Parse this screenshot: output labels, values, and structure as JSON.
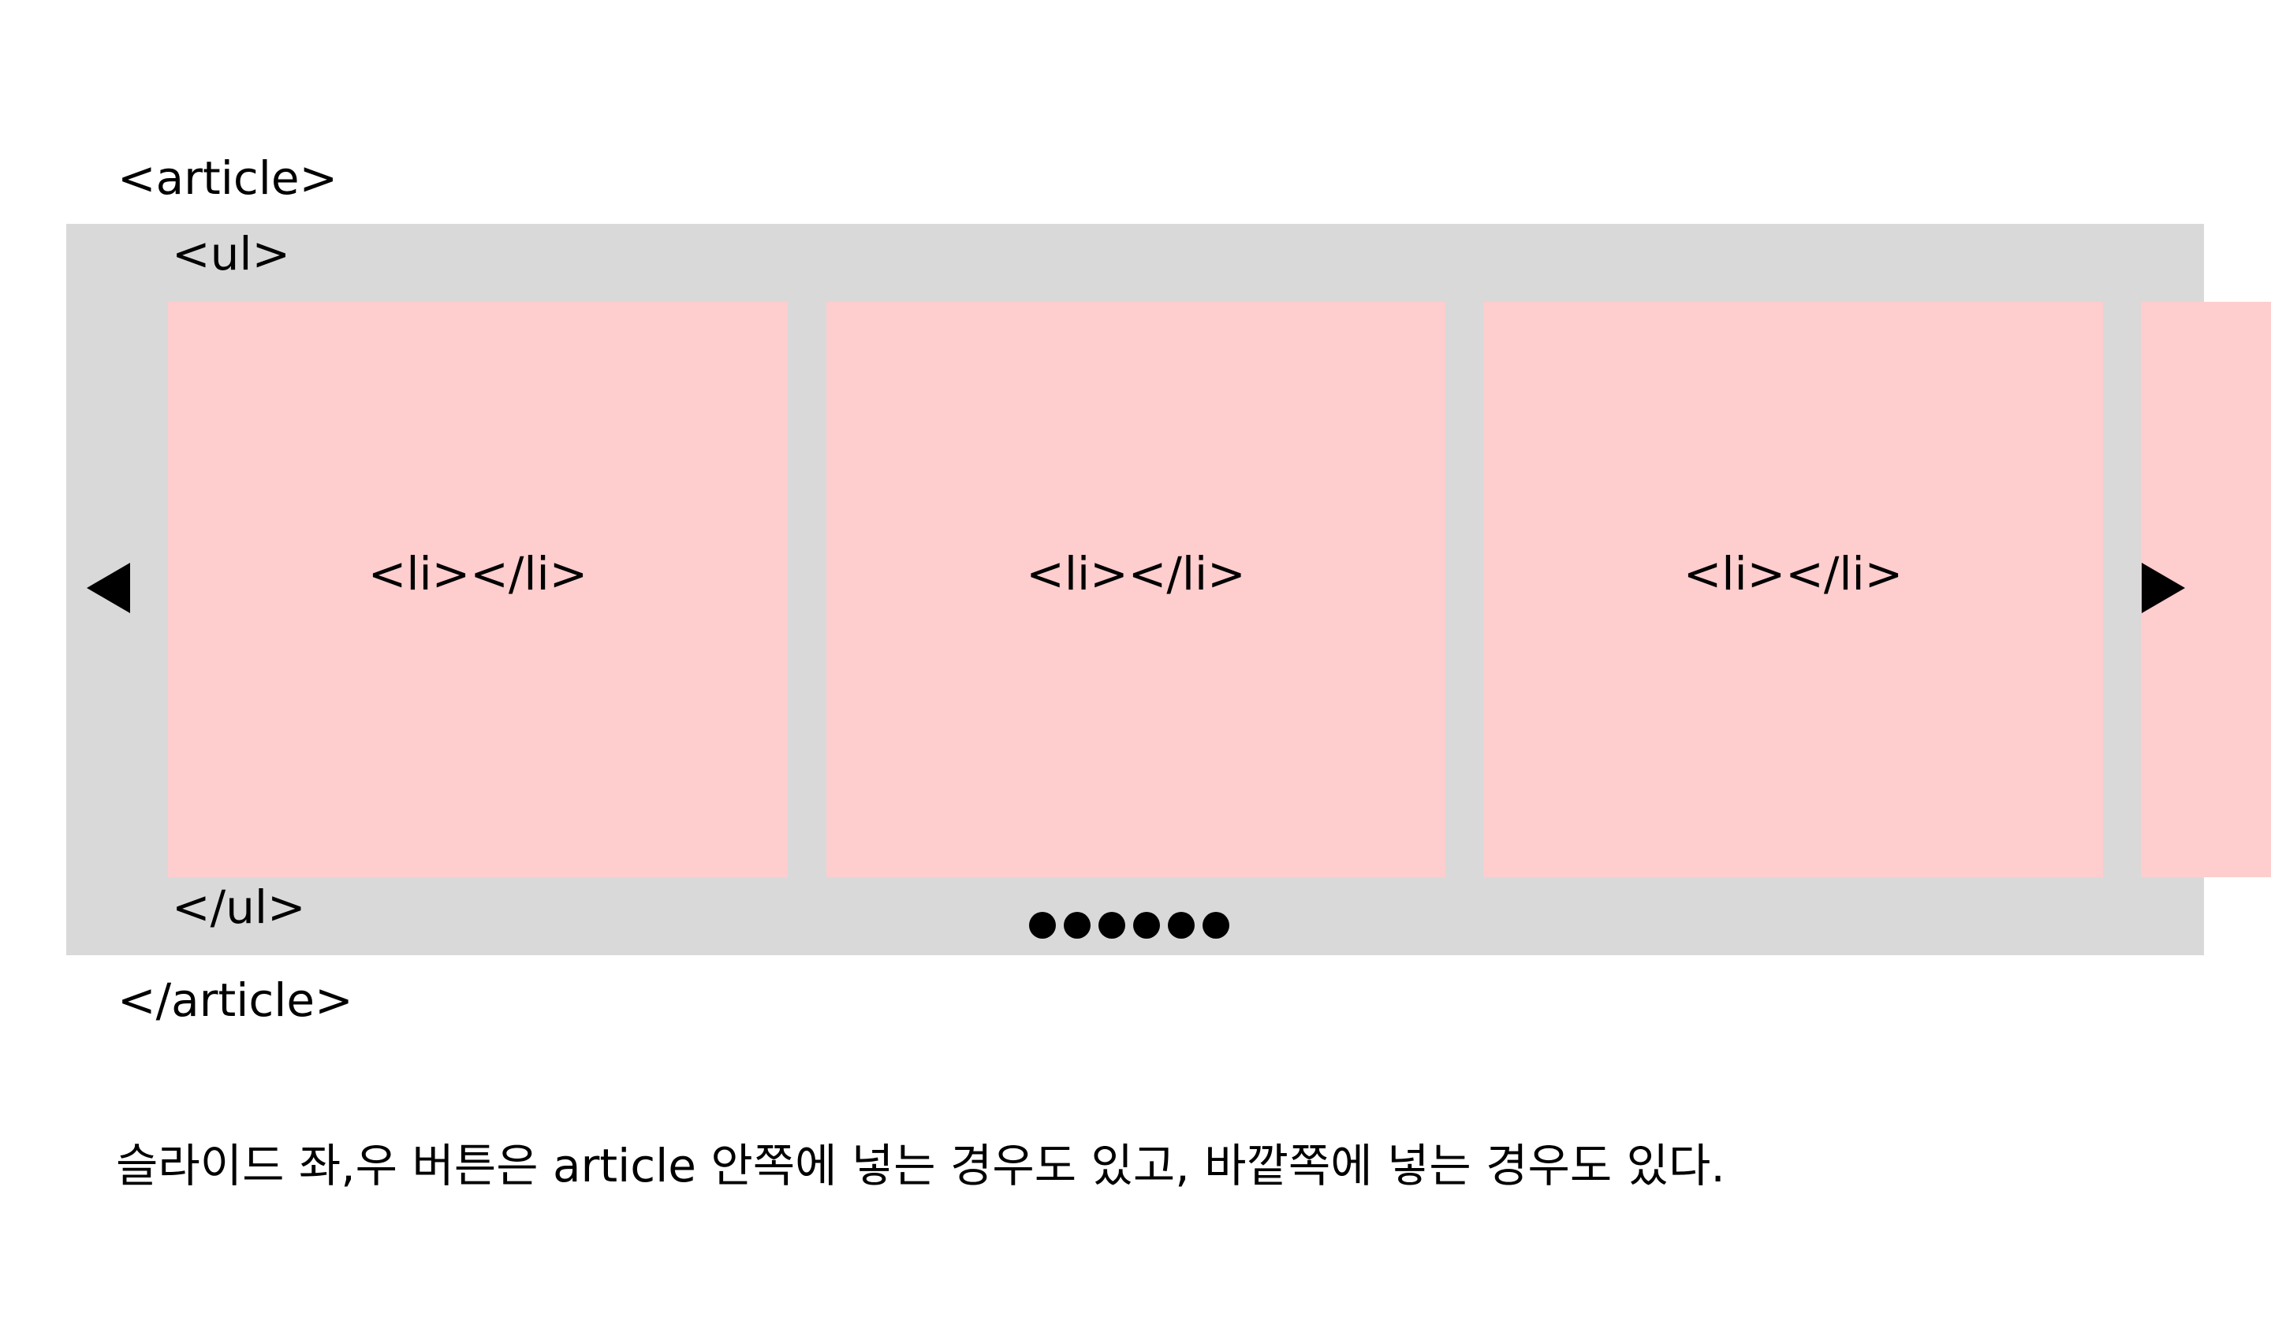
{
  "colors": {
    "background": "#ffffff",
    "article_box": "#d9d9d9",
    "slide": "#fecdcd",
    "text": "#000000",
    "arrow": "#000000",
    "dot": "#000000"
  },
  "diagram": {
    "article_open": "<article>",
    "article_close": "</article>",
    "ul_open": "<ul>",
    "ul_close": "</ul>",
    "slides": [
      {
        "label": "<li></li>"
      },
      {
        "label": "<li></li>"
      },
      {
        "label": "<li></li>"
      },
      {
        "label": ""
      }
    ],
    "prev_arrow_icon": "left-triangle-icon",
    "next_arrow_icon": "right-triangle-icon",
    "pager_dot_count": 6
  },
  "caption": "슬라이드 좌,우 버튼은 article 안쪽에 넣는 경우도 있고, 바깥쪽에 넣는 경우도 있다."
}
